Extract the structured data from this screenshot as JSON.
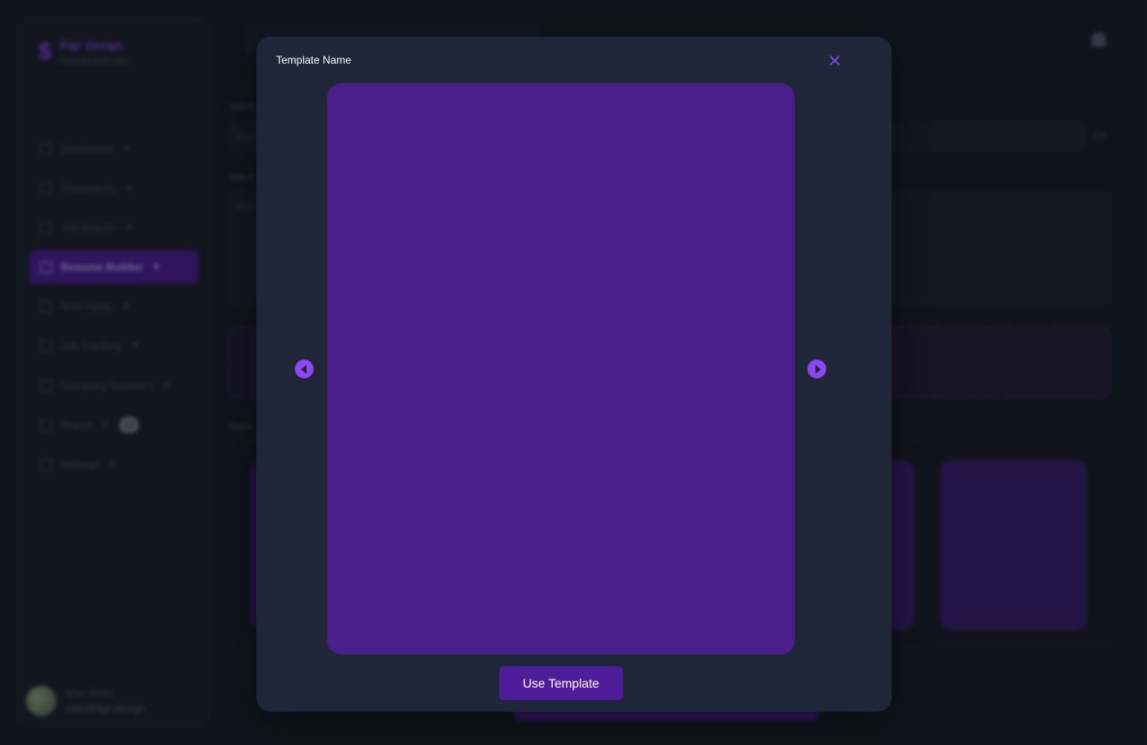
{
  "brand": {
    "name": "Figr design",
    "subtitle": "Dashboard tabs"
  },
  "sidebar": {
    "items": [
      {
        "label": "Dashboard",
        "icon": "grid-icon"
      },
      {
        "label": "Documents",
        "icon": "file-icon"
      },
      {
        "label": "Job Search",
        "icon": "file-icon"
      },
      {
        "label": "Resume Builder",
        "icon": "id-card-icon",
        "active": true
      },
      {
        "label": "Auto Apply",
        "icon": "file-icon"
      },
      {
        "label": "Job Tracking",
        "icon": "file-icon"
      },
      {
        "label": "Company Review's",
        "icon": "file-icon"
      },
      {
        "label": "Teams",
        "icon": "users-icon",
        "badge": "12"
      },
      {
        "label": "Settings",
        "icon": "gear-icon"
      }
    ]
  },
  "user": {
    "name": "Stan Wees",
    "email": "stan@figr.design"
  },
  "main": {
    "job_title_label": "Job Ti",
    "job_title_placeholder": "Ente",
    "or_label": "Or",
    "job_desc_label": "Job D",
    "job_desc_placeholder": "Ente",
    "choose_label": "Choo"
  },
  "modal": {
    "title": "Template Name",
    "use_button_label": "Use Template"
  },
  "colors": {
    "accent": "#8e45f2",
    "preview_fill": "#4a1f8c",
    "button_fill": "#4f1d9a",
    "modal_bg": "#1f2637",
    "page_bg": "#171b24"
  }
}
